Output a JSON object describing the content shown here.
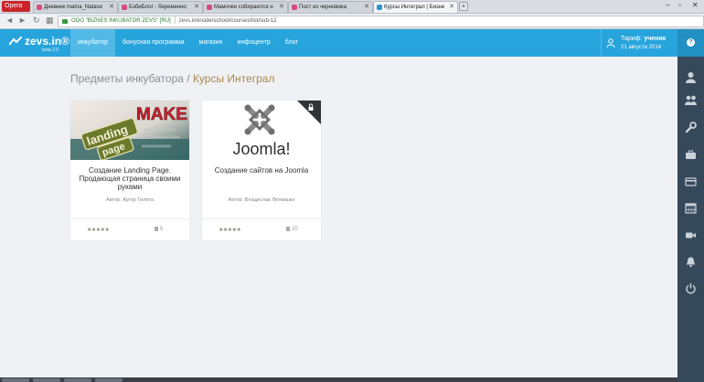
{
  "browser": {
    "app_button": "Opera",
    "tabs": [
      {
        "label": "Дневник mama_Natasи"
      },
      {
        "label": "БэбиБлог - беременно"
      },
      {
        "label": "Мамочки собираются н"
      },
      {
        "label": "Пост из черновика"
      },
      {
        "label": "Курсы Интеграл | Бизне"
      }
    ],
    "url_cert": "ООО \"BIZNES INKUBATOR ZEVS\" [RU]",
    "url": "zevs.in/inside/school/courses/list/sub-12"
  },
  "header": {
    "logo": "zevs.in®",
    "logo_beta": "beta 2.0",
    "menu": [
      "инкубатор",
      "бонусная программа",
      "магазин",
      "инфоцентр",
      "блог"
    ],
    "plan_label": "Тариф:",
    "plan_value": "ученик",
    "plan_date": "21 августа 2014"
  },
  "page": {
    "title_main": "Предметы инкубатора / ",
    "title_sub": "Курсы Интеграл"
  },
  "cards": [
    {
      "title": "Создание Landing Page. Продающая страница своими руками",
      "author_label": "Автор:",
      "author": "Артур Гилета",
      "stars": "★★★★★",
      "lessons": "5",
      "thumb_words": [
        "MAKE",
        "landing",
        "page"
      ]
    },
    {
      "title": "Создание сайтов на Joomla",
      "author_label": "Автор:",
      "author": "Владислав Литвишко",
      "stars": "★★★★★",
      "lessons": "20",
      "thumb_words": [
        "Joomla!"
      ]
    }
  ],
  "sidebar_icons": [
    "user-icon",
    "group-icon",
    "wrench-icon",
    "briefcase-icon",
    "card-icon",
    "calendar-icon",
    "video-icon",
    "bell-icon",
    "power-icon"
  ],
  "colors": {
    "header": "#27a4dc",
    "sidebar": "#36495a",
    "accent_title": "#a8884c"
  }
}
